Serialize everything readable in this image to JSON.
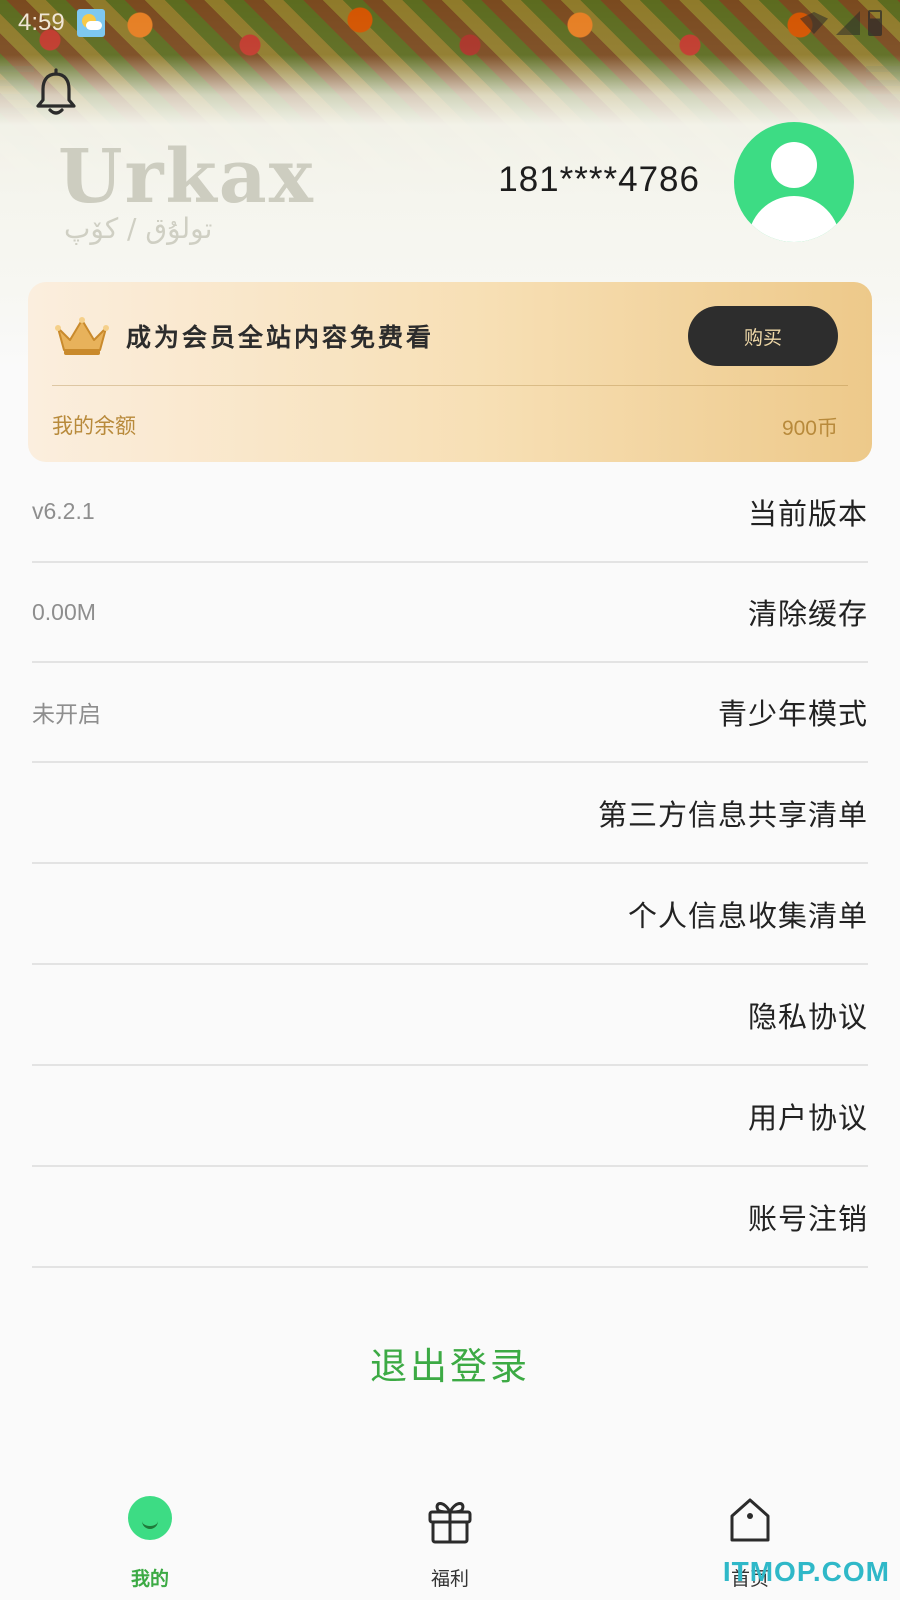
{
  "status_bar": {
    "time": "4:59"
  },
  "header": {
    "logo_text": "Urkax",
    "logo_subtitle": "تولۇق / كۆپ",
    "phone": "181****4786"
  },
  "vip_card": {
    "title": "成为会员全站内容免费看",
    "buy_label": "购买",
    "balance_label": "我的余额",
    "balance_value": "900币"
  },
  "settings": [
    {
      "label": "当前版本",
      "value": "v6.2.1"
    },
    {
      "label": "清除缓存",
      "value": "0.00M"
    },
    {
      "label": "青少年模式",
      "value": "未开启"
    },
    {
      "label": "第三方信息共享清单",
      "value": ""
    },
    {
      "label": "个人信息收集清单",
      "value": ""
    },
    {
      "label": "隐私协议",
      "value": ""
    },
    {
      "label": "用户协议",
      "value": ""
    },
    {
      "label": "账号注销",
      "value": ""
    }
  ],
  "logout_label": "退出登录",
  "bottom_nav": {
    "me": "我的",
    "welfare": "福利",
    "home": "首页",
    "active": "me"
  },
  "watermark": "ITMOP.COM",
  "colors": {
    "accent_green": "#3caa44",
    "avatar_green": "#3ddc84",
    "gold_text": "#b88a3b",
    "buy_button_bg": "#2d2d2d"
  },
  "icons": {
    "notification": "bell-icon",
    "avatar": "user-avatar-icon",
    "vip": "crown-icon",
    "nav_me": "smile-face-icon",
    "nav_welfare": "gift-icon",
    "nav_home": "home-bag-icon"
  }
}
